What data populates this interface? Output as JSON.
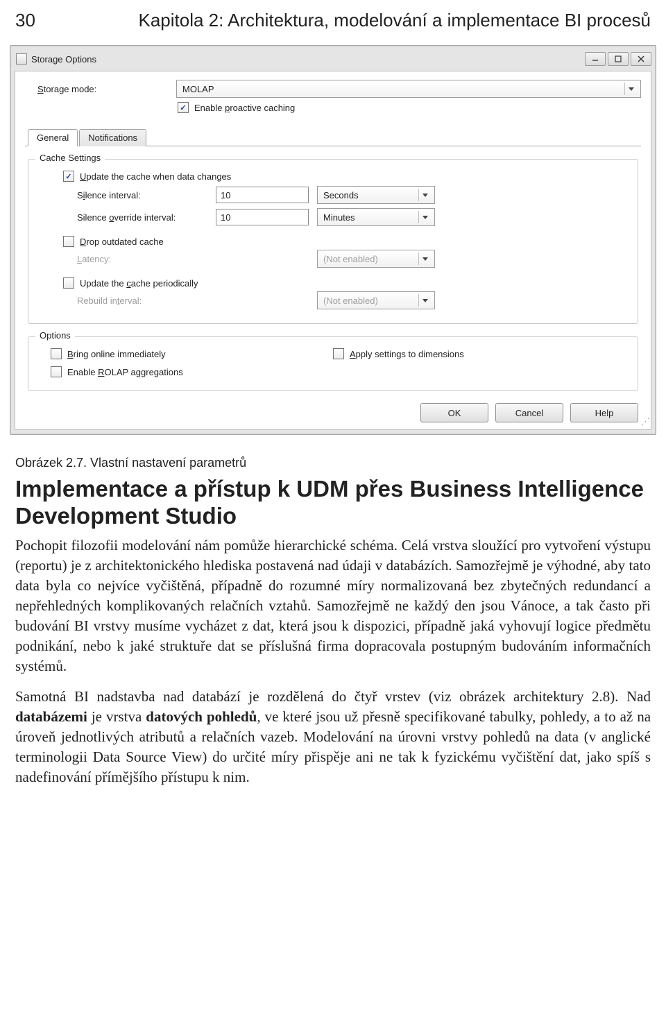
{
  "page": {
    "num": "30",
    "chapter": "Kapitola 2: Architektura, modelování a implementace BI procesů"
  },
  "win": {
    "title": "Storage Options",
    "storage_mode_label": "Storage mode:",
    "storage_mode_value": "MOLAP",
    "enable_proactive": "Enable proactive caching",
    "tabs": {
      "general": "General",
      "notifications": "Notifications"
    },
    "cache_group_title": "Cache Settings",
    "update_cache": "Update the cache when data changes",
    "silence_interval": {
      "label": "Silence interval:",
      "value": "10",
      "unit": "Seconds"
    },
    "silence_override": {
      "label": "Silence override interval:",
      "value": "10",
      "unit": "Minutes"
    },
    "drop_outdated": "Drop outdated cache",
    "latency": {
      "label": "Latency:",
      "value": "(Not enabled)"
    },
    "update_periodically": "Update the cache periodically",
    "rebuild": {
      "label": "Rebuild interval:",
      "value": "(Not enabled)"
    },
    "options_group_title": "Options",
    "bring_online": "Bring online immediately",
    "enable_rolap": "Enable ROLAP aggregations",
    "apply_dims": "Apply settings to dimensions",
    "ok": "OK",
    "cancel": "Cancel",
    "help": "Help"
  },
  "article": {
    "caption": "Obrázek 2.7. Vlastní nastavení parametrů",
    "heading": "Implementace a přístup k UDM přes Business Intelligence Development Studio",
    "p1": "Pochopit filozofii modelování nám pomůže hierarchické schéma. Celá vrstva sloužící pro vytvoření výstupu (reportu) je z architektonického hlediska postavená nad údaji v databázích. Samozřejmě je výhodné, aby tato data byla co nejvíce vyčištěná, případně do rozumné míry normalizovaná bez zbytečných redundancí a nepřehledných komplikovaných relačních vztahů. Samozřejmě ne každý den jsou Vánoce, a tak často při budování BI vrstvy musíme vycházet z dat, která jsou k dispozici, případně jaká vyhovují logice předmětu podnikání, nebo k jaké struktuře dat se příslušná firma dopracovala postupným budováním informačních systémů.",
    "p2_a": "Samotná BI nadstavba nad databází je rozdělená do čtyř vrstev (viz obrázek architektury 2.8). Nad ",
    "p2_db": "databázemi",
    "p2_b": " je vrstva ",
    "p2_dp": "datových pohledů",
    "p2_c": ", ve které jsou už přesně specifikované tabulky, pohledy, a to až na úroveň jednotlivých atributů a relačních vazeb. Modelování na úrovni vrstvy pohledů na data (v anglické terminologii Data Source View) do určité míry přispěje ani ne tak k fyzickému vyčištění dat, jako spíš s nadefinování přímějšího přístupu k nim."
  }
}
